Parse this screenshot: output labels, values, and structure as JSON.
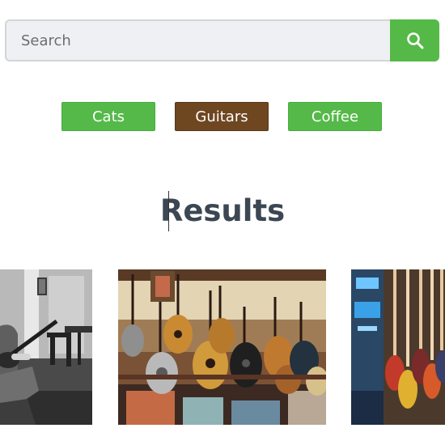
{
  "search": {
    "placeholder": "Search",
    "button_icon": "search-icon"
  },
  "categories": [
    {
      "label": "Cats",
      "color": "#54b948"
    },
    {
      "label": "Guitars",
      "color": "#6e4620",
      "selected": true
    },
    {
      "label": "Coffee",
      "color": "#54b948"
    }
  ],
  "results": {
    "heading": "Results",
    "images": [
      {
        "subject": "man playing guitar at home, black-and-white photo"
      },
      {
        "subject": "guitar shop display with acoustic guitars"
      },
      {
        "subject": "wall of electric guitars in a store"
      }
    ]
  },
  "colors": {
    "accent": "#54b948",
    "selected": "#6e4620",
    "heading": "#3b4753"
  }
}
